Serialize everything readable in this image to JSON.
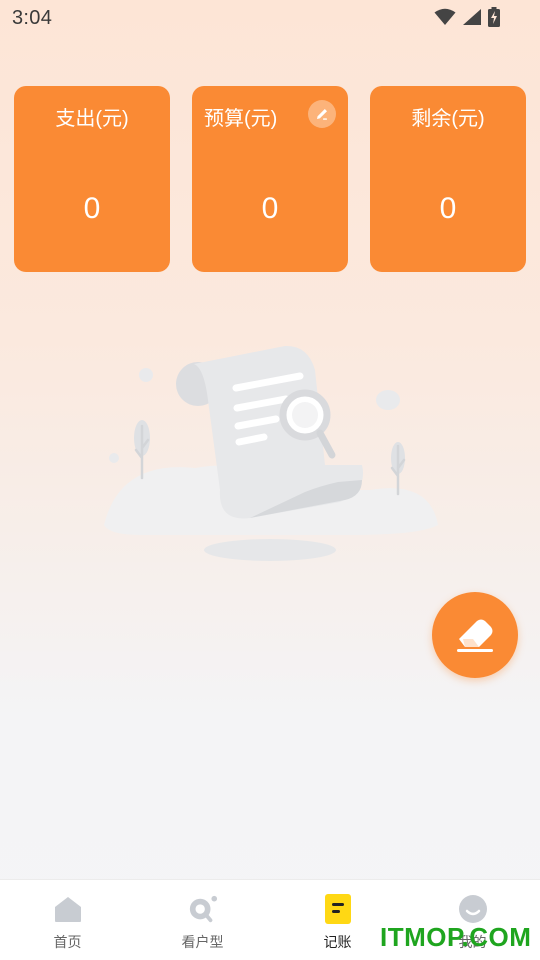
{
  "status_bar": {
    "time": "3:04"
  },
  "cards": [
    {
      "title": "支出(元)",
      "value": "0"
    },
    {
      "title": "预算(元)",
      "value": "0",
      "edit_icon": "pencil-icon"
    },
    {
      "title": "剩余(元)",
      "value": "0"
    }
  ],
  "colors": {
    "accent": "#fa8a34",
    "active_nav": "#ffd814",
    "inactive_icon": "#c8ccd2",
    "watermark": "#1fa51f"
  },
  "empty_state": {
    "illustration": "search-document-icon"
  },
  "fab": {
    "icon": "eraser-icon"
  },
  "nav": [
    {
      "label": "首页",
      "icon": "home-icon"
    },
    {
      "label": "看户型",
      "icon": "search-icon"
    },
    {
      "label": "记账",
      "icon": "ledger-icon",
      "active": true
    },
    {
      "label": "我的",
      "icon": "profile-icon"
    }
  ],
  "watermark": "ITMOP.COM"
}
